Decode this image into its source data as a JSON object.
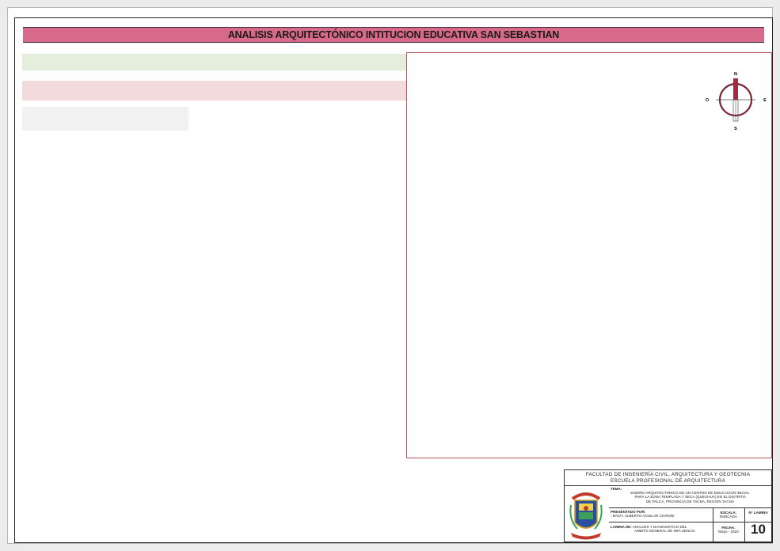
{
  "header": {
    "title": "ANALISIS ARQUITECTÓNICO  INTITUCION EDUCATIVA SAN SEBASTIAN"
  },
  "compass": {
    "north": "N",
    "south": "S",
    "east": "E",
    "west": "O"
  },
  "title_block": {
    "faculty": "FACULTAD DE INGENIERÍA CIVIL, ARQUITECTURA Y GEOTECNIA",
    "school": "ESCUELA PROFESIONAL DE ARQUITECTURA",
    "tema_label": "TEMA:",
    "tema_line1": "DISEÑO ARQUITECTONICO DE UN CENTRO DE EDUCACION INICIAL",
    "tema_line2": "PARA LA ZONA TEMPLADA Y SECA (QUECHUA) EN EL DISTRITO",
    "tema_line3": "DE PALCA, PROVINCIA DE TACNA, REGION TACNA",
    "presentado_label": "PRESENTADO POR:",
    "presentado_value": "- BACH. ALBERTO AGUILAR CHANINI",
    "escala_label": "ESCALA:",
    "escala_value": "INDICADA",
    "lamina_label": "N° LAMINA",
    "lamina_number": "10",
    "lamina_de_label": "LAMINA DE:",
    "lamina_de_line1": "ANALISIS Y DIAGNOSTICO DEL",
    "lamina_de_line2": "AMBITO GENERAL DE INFLUENCIA",
    "fecha_label": "FECHA:",
    "fecha_value": "Mayo - 2020"
  },
  "colors": {
    "title_bar": "#d9698b",
    "green_band": "#e3efdc",
    "pink_band": "#f3dadd",
    "panel_border": "#b3515e"
  }
}
